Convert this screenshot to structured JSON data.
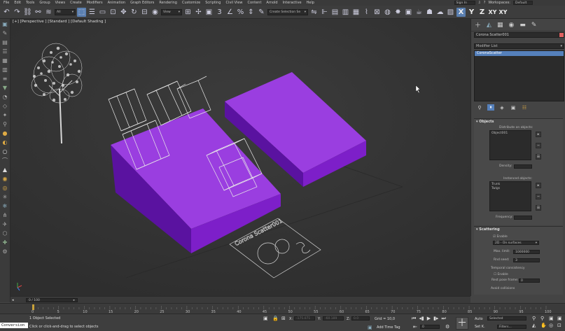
{
  "menus": [
    "File",
    "Edit",
    "Tools",
    "Group",
    "Views",
    "Create",
    "Modifiers",
    "Animation",
    "Graph Editors",
    "Rendering",
    "Customize",
    "Scripting",
    "Civil View",
    "Content",
    "Arnold",
    "Interactive",
    "Help"
  ],
  "signin": "Sign In",
  "workspaces_label": "Workspaces:",
  "workspace_value": "Default",
  "toolbar": {
    "filter": "All",
    "view": "View",
    "selection_set": "Create Selection Se"
  },
  "viewport": {
    "label": "[+] [Perspective ] [Standard ] [Default Shading ]",
    "scatter_text": "Corona Scatter001"
  },
  "panel": {
    "object_name": "Corona Scatter001",
    "modifier_list": "Modifier List",
    "stack_item": "CoronaScatter",
    "objects_header": "Objects",
    "distribute_label": "Distribute on objects:",
    "distribute_items": [
      "Object001"
    ],
    "density_label": "Density:",
    "instanced_label": "Instanced objects:",
    "instanced_items": [
      "Trunk",
      "Twigs"
    ],
    "frequency_label": "Frequency:",
    "scattering_header": "Scattering",
    "enable_label": "Enable",
    "mode_value": "2D - On surfaces",
    "max_limit_label": "Max. limit:",
    "max_limit_value": "1000000",
    "rnd_seed_label": "Rnd seed:",
    "rnd_seed_value": "3",
    "temporal_label": "Temporal consistency",
    "temporal_enable": "Enable",
    "rest_pose_label": "Rest pose frame:",
    "rest_pose_value": "0",
    "avoid_label": "Avoid collisions"
  },
  "timeline": {
    "frame_counter": "0 / 100",
    "ticks": [
      "0",
      "5",
      "10",
      "15",
      "20",
      "25",
      "30",
      "35",
      "40",
      "45",
      "50",
      "55",
      "60",
      "65",
      "70",
      "75",
      "80",
      "85",
      "90",
      "95",
      "100"
    ]
  },
  "status": {
    "selected": "1 Object Selected",
    "prompt": "Click or click-and-drag to select objects",
    "x_label": "X:",
    "x_value": "-175.071",
    "y_label": "Y:",
    "y_value": "-60.189",
    "z_label": "Z:",
    "z_value": "0.0",
    "grid": "Grid = 10,0",
    "add_time_tag": "Add Time Tag",
    "auto": "Auto",
    "set_k": "Set K.",
    "key_mode": "Selected",
    "filters": "Filters...",
    "frame": "0",
    "maxscript": "Conversion"
  },
  "colors": {
    "box": "#7d1fc9",
    "box_top": "#9a3ee0",
    "box_side": "#5a12a0",
    "accent": "#5580bb"
  }
}
